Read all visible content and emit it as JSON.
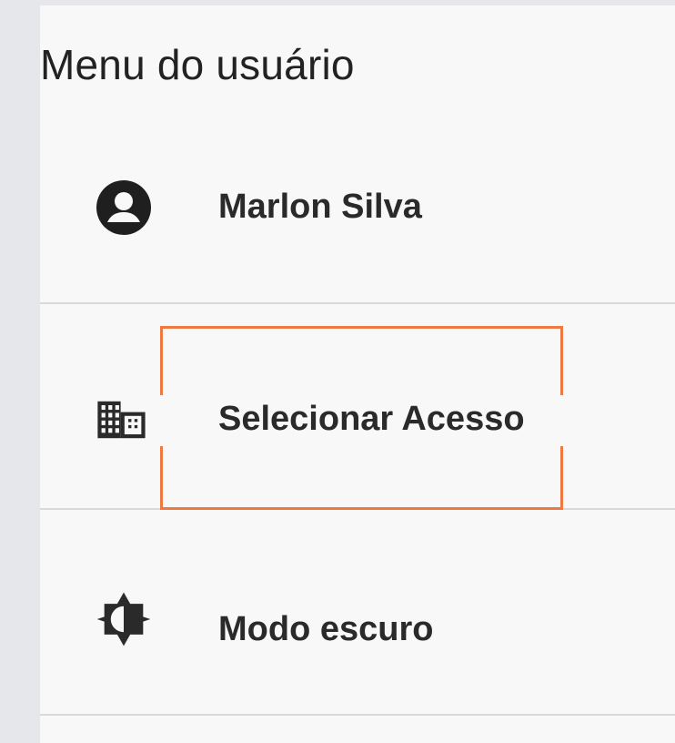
{
  "menu": {
    "title": "Menu do usuário",
    "items": [
      {
        "label": "Marlon Silva",
        "icon": "account-circle-icon"
      },
      {
        "label": "Selecionar Acesso",
        "icon": "building-icon",
        "highlighted": true
      },
      {
        "label": "Modo escuro",
        "icon": "brightness-icon"
      }
    ]
  },
  "colors": {
    "background": "#f8f8f8",
    "sidebar": "#e5e7ea",
    "text": "#2a2a2a",
    "divider": "#d9d9d9",
    "highlight": "#ee7a42"
  }
}
